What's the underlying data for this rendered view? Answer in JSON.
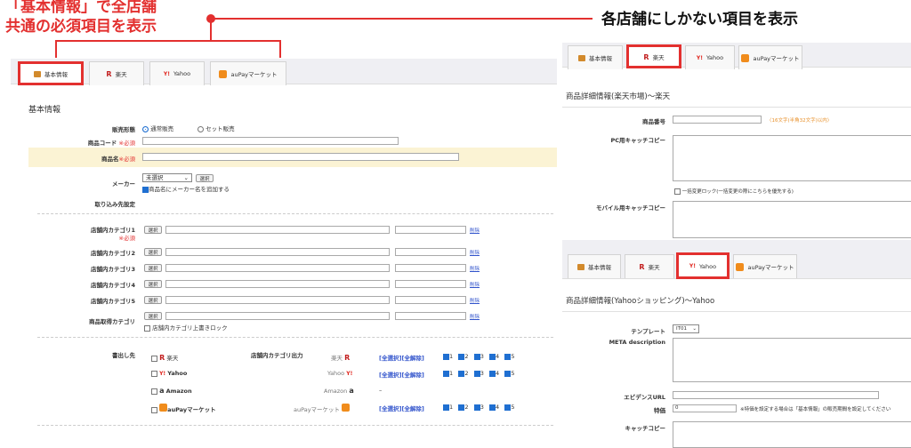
{
  "annotations": {
    "left_line1": "「基本情報」で全店舗",
    "left_line2": "共通の必須項目を表示",
    "right": "各店舗にしかない項目を表示"
  },
  "tabs": [
    "基本情報",
    "楽天",
    "Yahoo",
    "auPayマーケット"
  ],
  "main": {
    "section_title": "基本情報",
    "sales_label": "販売形態",
    "sales_opt1": "通常販売",
    "sales_opt2": "セット販売",
    "code_label": "商品コード",
    "required": "※必須",
    "name_label": "商品名",
    "maker_label": "メーカー",
    "maker_select": "未選択",
    "select_btn": "選択",
    "maker_check": "商品名にメーカー名を追加する",
    "import_label": "取り込み先設定",
    "cat1": "店舗内カテゴリ1",
    "cat2": "店舗内カテゴリ2",
    "cat3": "店舗内カテゴリ3",
    "cat4": "店舗内カテゴリ4",
    "cat5": "店舗内カテゴリ5",
    "product_cat": "商品取得カテゴリ",
    "delete": "削除",
    "lock_check": "店舗内カテゴリ上書きロック",
    "export_label": "書出し先",
    "cat_output": "店舗内カテゴリ出力",
    "dest_rakuten": "楽天",
    "dest_yahoo": "Yahoo",
    "dest_amazon": "Amazon",
    "dest_au": "auPayマーケット",
    "out_rakuten": "楽天",
    "out_yahoo": "Yahoo",
    "out_amazon": "Amazon",
    "out_au": "auPayマーケット",
    "select_all": "[全選択]",
    "deselect_all": "[全解除]",
    "dash": "–",
    "n1": "1",
    "n2": "2",
    "n3": "3",
    "n4": "4",
    "n5": "5"
  },
  "rakuten": {
    "title": "商品詳細情報(楽天市場)～楽天",
    "item_no": "商品番号",
    "item_no_hint": "〈16文字(半角32文字)以内〉",
    "pc_copy": "PC用キャッチコピー",
    "lock_note": "一括変更ロック(一括変更の際にこちらを優先する)",
    "mobile_copy": "モバイル用キャッチコピー"
  },
  "yahoo": {
    "title": "商品詳細情報(Yahooショッピング)～Yahoo",
    "template": "テンプレート",
    "template_val": "IT01",
    "meta": "META description",
    "evidence": "エビデンスURL",
    "special_price": "特価",
    "special_val": "0",
    "special_note": "※特価を設定する場合は「基本情報」の販売期間を設定してください",
    "catch": "キャッチコピー"
  },
  "colors": {
    "accent": "#e3302f",
    "highlight": "#fbf3d4",
    "check": "#1f6fd1"
  }
}
